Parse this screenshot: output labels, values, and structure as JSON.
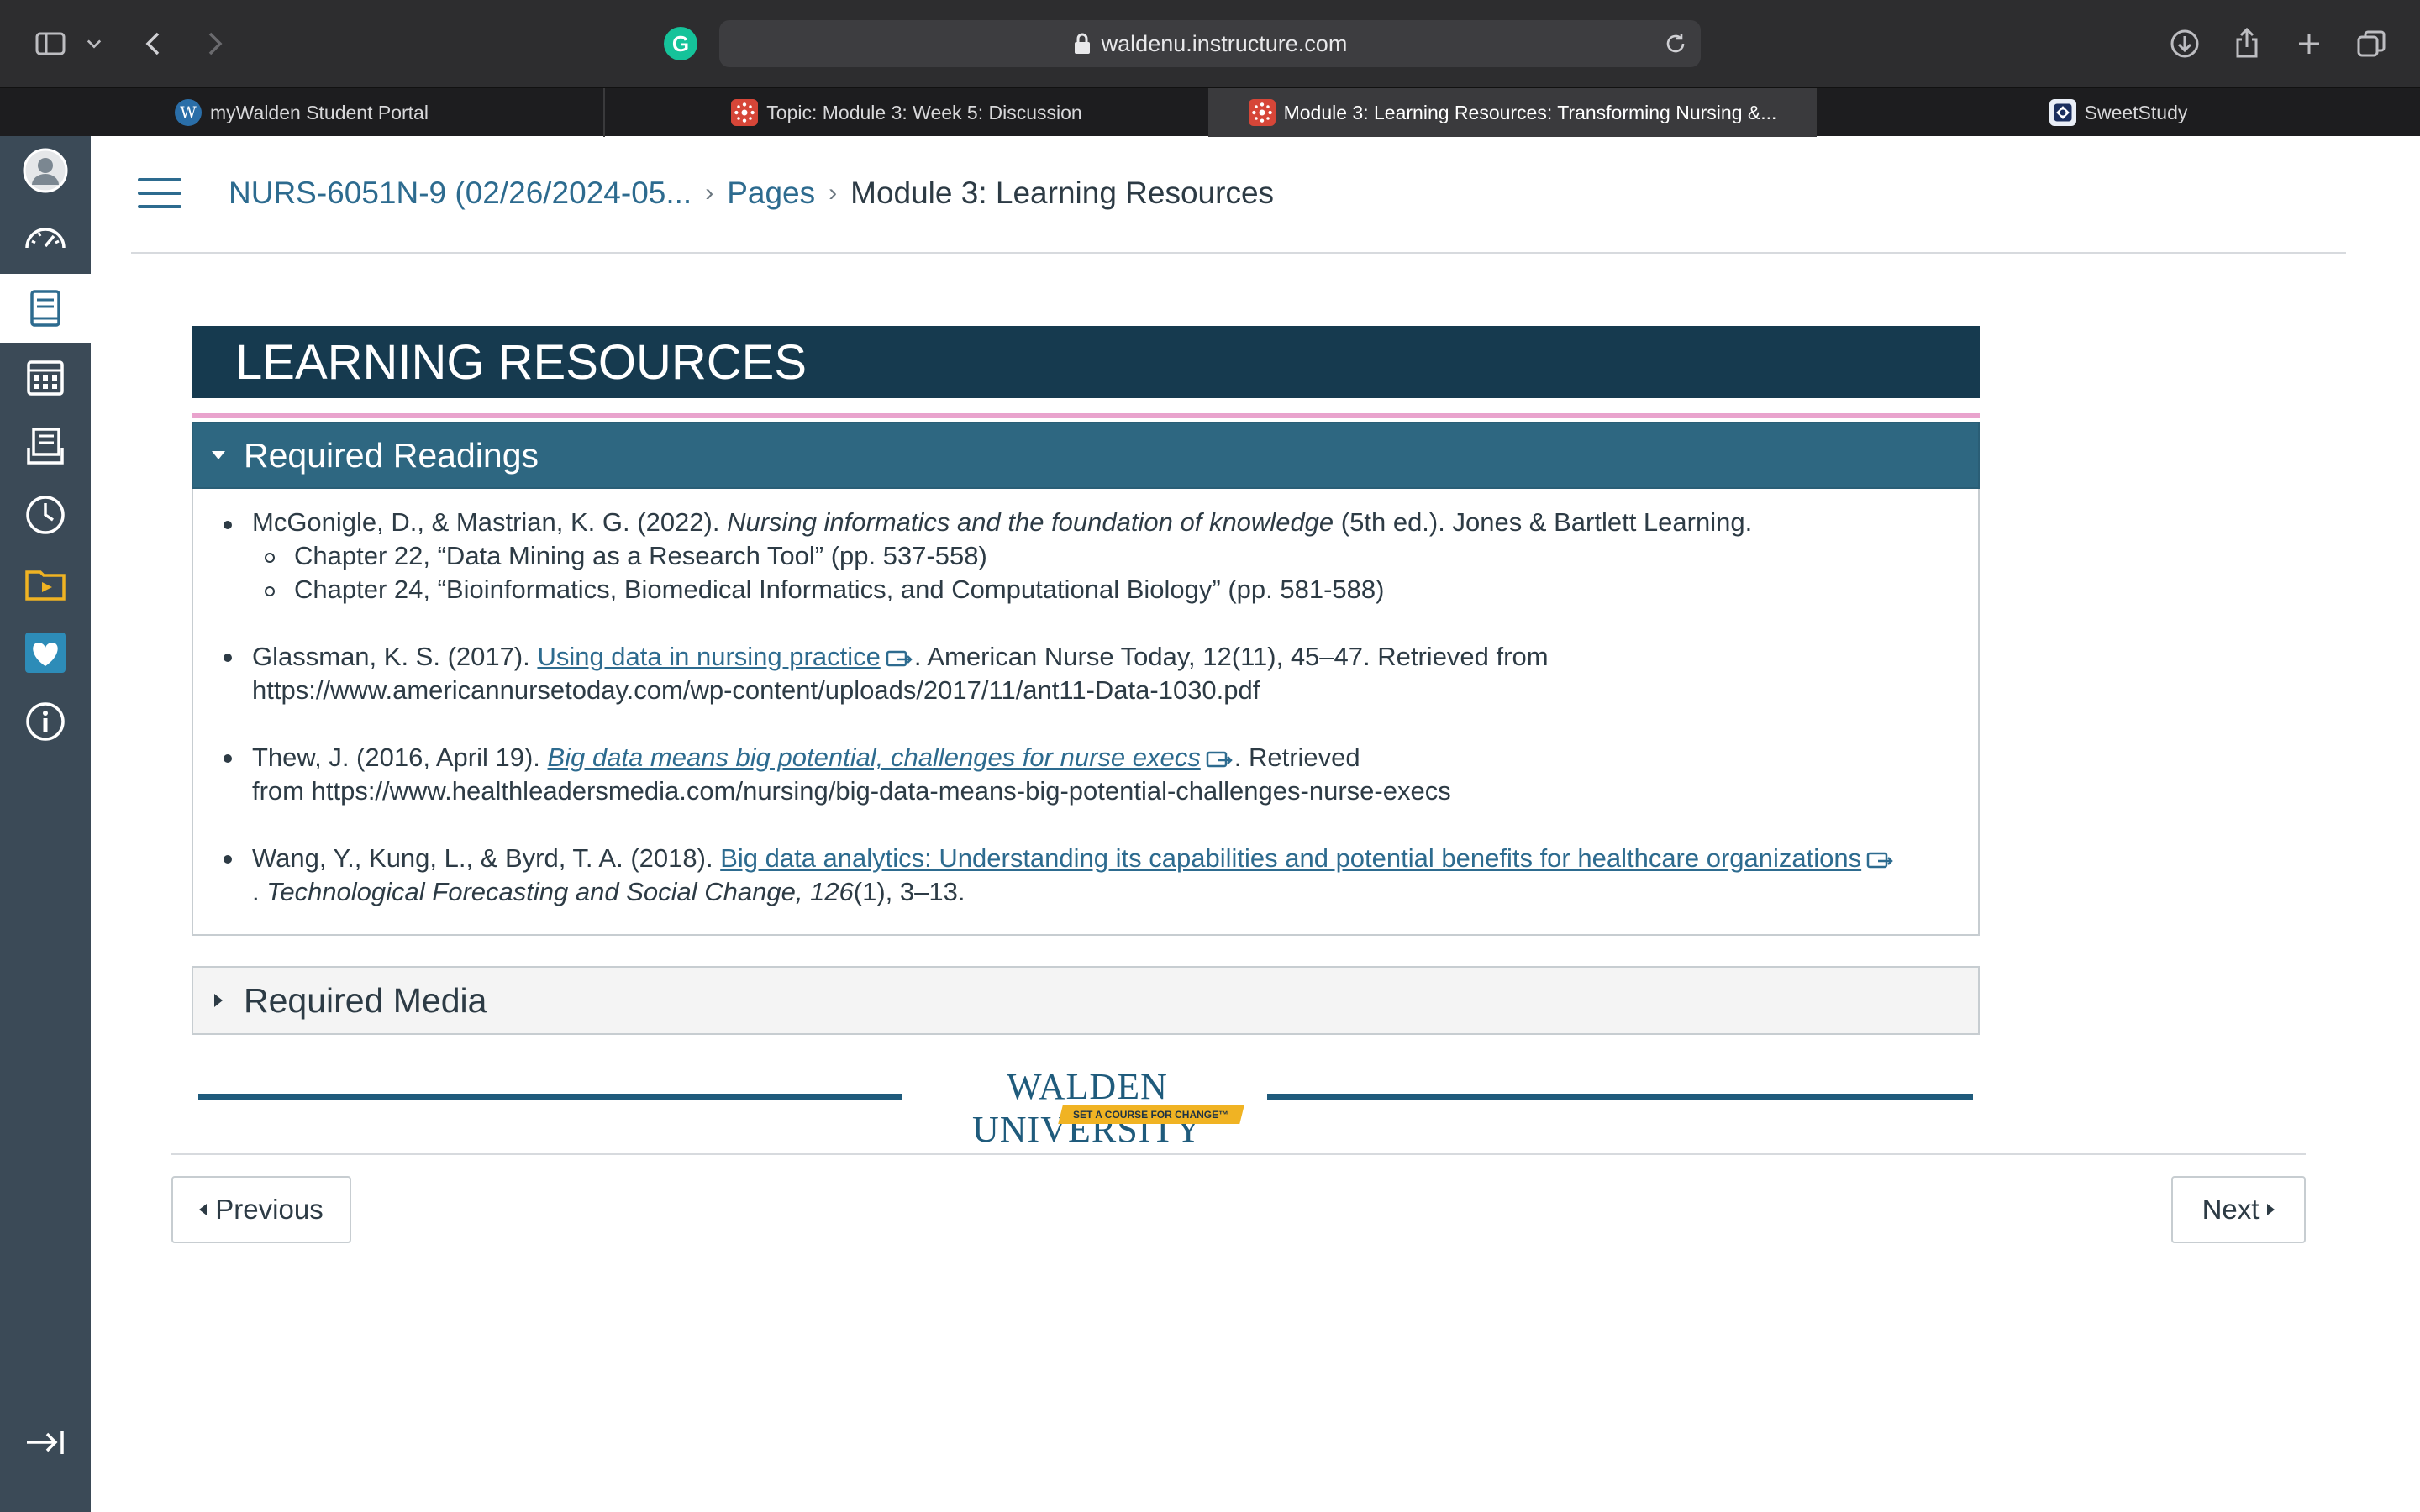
{
  "browser": {
    "url": "waldenu.instructure.com",
    "tabs": [
      {
        "label": "myWalden Student Portal",
        "icon": "walden-w-icon",
        "fav_text": "W"
      },
      {
        "label": "Topic: Module 3: Week 5: Discussion",
        "icon": "canvas-icon"
      },
      {
        "label": "Module 3: Learning Resources: Transforming Nursing &...",
        "icon": "canvas-icon"
      },
      {
        "label": "SweetStudy",
        "icon": "sweetstudy-icon"
      }
    ],
    "active_tab": 2,
    "grammarly_letter": "G"
  },
  "global_nav": {
    "items": [
      "account",
      "dashboard",
      "courses",
      "calendar",
      "inbox",
      "history",
      "commons",
      "studio",
      "help"
    ],
    "active": "courses",
    "collapse": "collapse-nav"
  },
  "breadcrumb": {
    "course": "NURS-6051N-9 (02/26/2024-05...",
    "section": "Pages",
    "current": "Module 3: Learning Resources"
  },
  "banner": {
    "title": "LEARNING RESOURCES"
  },
  "required_readings": {
    "heading": "Required Readings",
    "expanded": true,
    "refs": {
      "r1": {
        "authors": "McGonigle, D., & Mastrian, K. G. (2022).",
        "title": "Nursing informatics and the foundation of knowledge",
        "rest": "(5th ed.). Jones & Bartlett Learning.",
        "chapters": [
          "Chapter 22, “Data Mining as a Research Tool” (pp. 537-558)",
          "Chapter 24, “Bioinformatics, Biomedical Informatics, and Computational Biology” (pp. 581-588)"
        ]
      },
      "r2": {
        "authors": "Glassman, K. S. (2017).",
        "link": "Using data in nursing practice",
        "rest": ". American Nurse Today, 12(11), 45–47. Retrieved from",
        "url": "https://www.americannursetoday.com/wp-content/uploads/2017/11/ant11-Data-1030.pdf"
      },
      "r3": {
        "authors": "Thew, J. (2016, April 19).",
        "link": "Big data means big potential, challenges for nurse execs",
        "rest": ". Retrieved",
        "url": "from https://www.healthleadersmedia.com/nursing/big-data-means-big-potential-challenges-nurse-execs"
      },
      "r4": {
        "authors": "Wang, Y., Kung, L., & Byrd, T. A. (2018).",
        "link": "Big data analytics: Understanding its capabilities and potential benefits for healthcare organizations",
        "journal_pre": ". ",
        "journal": "Technological Forecasting and Social Change, 126",
        "journal_rest": "(1), 3–13."
      }
    }
  },
  "required_media": {
    "heading": "Required Media",
    "expanded": false
  },
  "logo": {
    "name": "WALDEN UNIVERSITY",
    "tagline": "SET A COURSE FOR CHANGE™"
  },
  "pagination": {
    "previous": "Previous",
    "next": "Next"
  },
  "colors": {
    "banner": "#163a4f",
    "accordion": "#2e6781",
    "link": "#2d6b8f",
    "nav": "#3b4a57",
    "accent_rule": "#e9a3cd",
    "logo_gold": "#f0b323"
  }
}
